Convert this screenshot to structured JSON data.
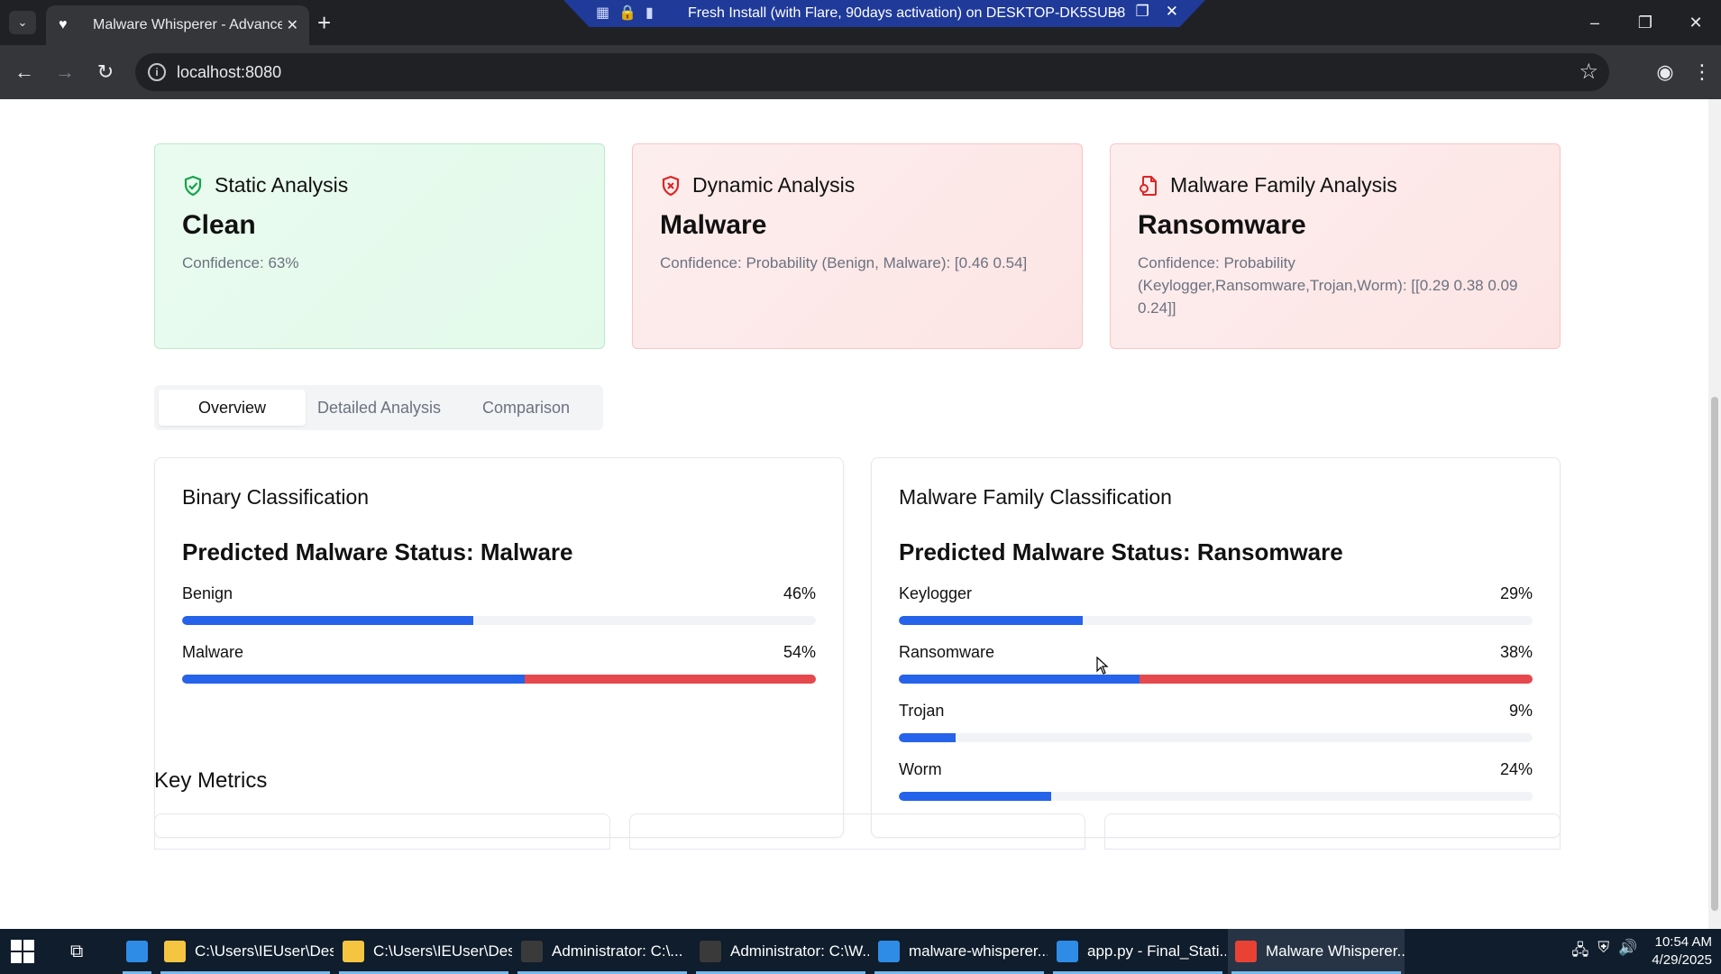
{
  "browser": {
    "tab_title": "Malware Whisperer - Advanced",
    "url": "localhost:8080",
    "remote_title": "Fresh Install (with Flare, 90days activation) on DESKTOP-DK5SUB8"
  },
  "cards": [
    {
      "title": "Static Analysis",
      "verdict": "Clean",
      "confidence": "Confidence: 63%",
      "tone": "green",
      "icon": "shield-check-icon"
    },
    {
      "title": "Dynamic Analysis",
      "verdict": "Malware",
      "confidence": "Confidence: Probability (Benign, Malware): [0.46 0.54]",
      "tone": "red",
      "icon": "shield-x-icon"
    },
    {
      "title": "Malware Family Analysis",
      "verdict": "Ransomware",
      "confidence": "Confidence: Probability (Keylogger,Ransomware,Trojan,Worm): [[0.29 0.38 0.09 0.24]]",
      "tone": "red",
      "icon": "file-warning-icon"
    }
  ],
  "tabs": [
    {
      "label": "Overview",
      "active": true
    },
    {
      "label": "Detailed Analysis",
      "active": false
    },
    {
      "label": "Comparison",
      "active": false
    }
  ],
  "binary": {
    "title": "Binary Classification",
    "status": "Predicted Malware Status: Malware",
    "rows": [
      {
        "label": "Benign",
        "value": 46,
        "display": "46%",
        "highlight": false
      },
      {
        "label": "Malware",
        "value": 54,
        "display": "54%",
        "highlight": true
      }
    ]
  },
  "family": {
    "title": "Malware Family Classification",
    "status": "Predicted Malware Status: Ransomware",
    "rows": [
      {
        "label": "Keylogger",
        "value": 29,
        "display": "29%",
        "highlight": false
      },
      {
        "label": "Ransomware",
        "value": 38,
        "display": "38%",
        "highlight": true
      },
      {
        "label": "Trojan",
        "value": 9,
        "display": "9%",
        "highlight": false
      },
      {
        "label": "Worm",
        "value": 24,
        "display": "24%",
        "highlight": false
      }
    ]
  },
  "key_metrics": {
    "title": "Key Metrics"
  },
  "taskbar": {
    "items": [
      {
        "label": "",
        "icon_color": "#2f8ce6",
        "active": false
      },
      {
        "label": "C:\\Users\\IEUser\\Des...",
        "icon_color": "#f5c542",
        "active": false
      },
      {
        "label": "C:\\Users\\IEUser\\Des...",
        "icon_color": "#f5c542",
        "active": false
      },
      {
        "label": "Administrator: C:\\...",
        "icon_color": "#3a3a3a",
        "active": false
      },
      {
        "label": "Administrator: C:\\W...",
        "icon_color": "#3a3a3a",
        "active": false
      },
      {
        "label": "malware-whisperer...",
        "icon_color": "#2f8ce6",
        "active": false
      },
      {
        "label": "app.py - Final_Stati...",
        "icon_color": "#2f8ce6",
        "active": false
      },
      {
        "label": "Malware Whisperer...",
        "icon_color": "#e94235",
        "active": true
      }
    ],
    "time": "10:54 AM",
    "date": "4/29/2025"
  },
  "colors": {
    "primary_bar": "#2563eb",
    "highlight_bar": "#e5484d",
    "clean_tone": "#16a34a",
    "malware_tone": "#dc2626"
  }
}
